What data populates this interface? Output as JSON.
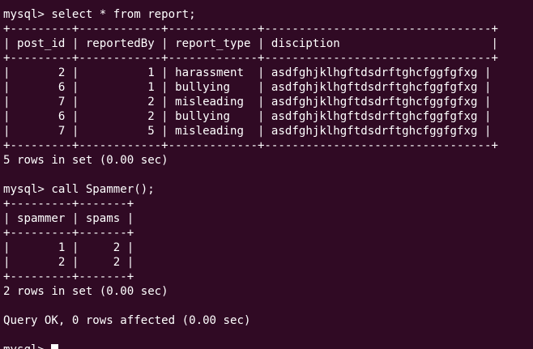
{
  "terminal": {
    "colors": {
      "background": "#300a24",
      "foreground": "#ffffff"
    },
    "lines": [
      "mysql> select * from report;",
      "+---------+------------+-------------+---------------------------------+",
      "| post_id | reportedBy | report_type | disciption                      |",
      "+---------+------------+-------------+---------------------------------+",
      "|       2 |          1 | harassment  | asdfghjklhgftdsdrftghcfggfgfxg |",
      "|       6 |          1 | bullying    | asdfghjklhgftdsdrftghcfggfgfxg |",
      "|       7 |          2 | misleading  | asdfghjklhgftdsdrftghcfggfgfxg |",
      "|       6 |          2 | bullying    | asdfghjklhgftdsdrftghcfggfgfxg |",
      "|       7 |          5 | misleading  | asdfghjklhgftdsdrftghcfggfgfxg |",
      "+---------+------------+-------------+---------------------------------+",
      "5 rows in set (0.00 sec)",
      "",
      "mysql> call Spammer();",
      "+---------+-------+",
      "| spammer | spams |",
      "+---------+-------+",
      "|       1 |     2 |",
      "|       2 |     2 |",
      "+---------+-------+",
      "2 rows in set (0.00 sec)",
      "",
      "Query OK, 0 rows affected (0.00 sec)",
      ""
    ],
    "prompt": "mysql> "
  }
}
